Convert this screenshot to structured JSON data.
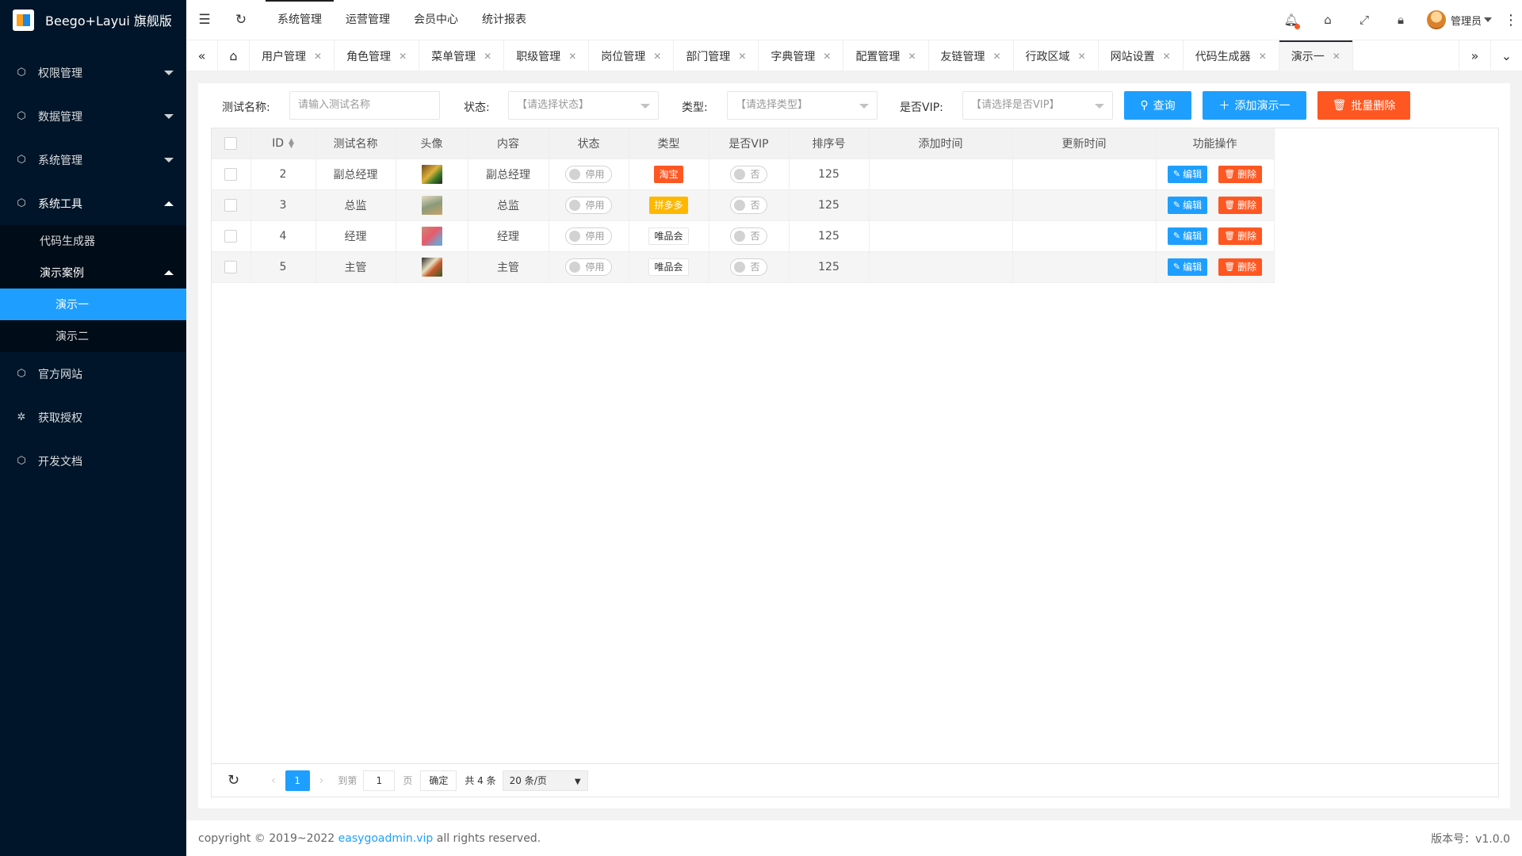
{
  "app": {
    "title": "Beego+Layui 旗舰版"
  },
  "sidebar": {
    "items": [
      {
        "label": "权限管理",
        "icon": "cube-icon"
      },
      {
        "label": "数据管理",
        "icon": "cube-icon"
      },
      {
        "label": "系统管理",
        "icon": "cube-icon"
      },
      {
        "label": "系统工具",
        "icon": "cube-icon"
      },
      {
        "label": "官方网站",
        "icon": "cube-icon"
      },
      {
        "label": "获取授权",
        "icon": "plugin-icon"
      },
      {
        "label": "开发文档",
        "icon": "cube-icon"
      }
    ],
    "tools_sub": {
      "code_gen": "代码生成器",
      "demo_case": "演示案例",
      "demo_one": "演示一",
      "demo_two": "演示二"
    }
  },
  "header": {
    "nav": [
      "系统管理",
      "运营管理",
      "会员中心",
      "统计报表"
    ],
    "user_name": "管理员"
  },
  "tabs": [
    "用户管理",
    "角色管理",
    "菜单管理",
    "职级管理",
    "岗位管理",
    "部门管理",
    "字典管理",
    "配置管理",
    "友链管理",
    "行政区域",
    "网站设置",
    "代码生成器",
    "演示一"
  ],
  "filter": {
    "name_label": "测试名称:",
    "name_placeholder": "请输入测试名称",
    "status_label": "状态:",
    "status_placeholder": "【请选择状态】",
    "type_label": "类型:",
    "type_placeholder": "【请选择类型】",
    "vip_label": "是否VIP:",
    "vip_placeholder": "【请选择是否VIP】",
    "search_btn": "查询",
    "add_btn": "添加演示一",
    "batch_delete_btn": "批量删除"
  },
  "table": {
    "columns": [
      "ID",
      "测试名称",
      "头像",
      "内容",
      "状态",
      "类型",
      "是否VIP",
      "排序号",
      "添加时间",
      "更新时间",
      "功能操作"
    ],
    "rows": [
      {
        "id": "2",
        "name": "副总经理",
        "content": "副总经理",
        "status": "停用",
        "type": "淘宝",
        "type_style": "red",
        "vip": "否",
        "sort": "125",
        "created": "",
        "updated": ""
      },
      {
        "id": "3",
        "name": "总监",
        "content": "总监",
        "status": "停用",
        "type": "拼多多",
        "type_style": "orange",
        "vip": "否",
        "sort": "125",
        "created": "",
        "updated": ""
      },
      {
        "id": "4",
        "name": "经理",
        "content": "经理",
        "status": "停用",
        "type": "唯品会",
        "type_style": "plain",
        "vip": "否",
        "sort": "125",
        "created": "",
        "updated": ""
      },
      {
        "id": "5",
        "name": "主管",
        "content": "主管",
        "status": "停用",
        "type": "唯品会",
        "type_style": "plain",
        "vip": "否",
        "sort": "125",
        "created": "",
        "updated": ""
      }
    ],
    "edit_label": "编辑",
    "delete_label": "删除"
  },
  "pager": {
    "current": "1",
    "goto_label": "到第",
    "goto_value": "1",
    "page_unit": "页",
    "ok_label": "确定",
    "total": "共 4 条",
    "page_size": "20 条/页"
  },
  "footer": {
    "copyright_prefix": "copyright © 2019~2022",
    "copyright_link": "easygoadmin.vip",
    "copyright_suffix": "all rights reserved.",
    "version": "版本号：v1.0.0"
  },
  "colors": {
    "primary": "#1e9fff",
    "danger": "#ff5722",
    "warn": "#ffb800",
    "sidebar": "#001529"
  }
}
